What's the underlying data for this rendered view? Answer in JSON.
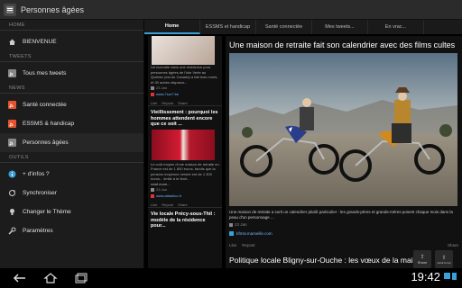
{
  "app": {
    "title": "Personnes âgées"
  },
  "sidebar": {
    "sections": [
      {
        "header": "HOME",
        "items": [
          {
            "label": "BIENVENUE",
            "icon": "home-icon"
          }
        ]
      },
      {
        "header": "TWEETS",
        "items": [
          {
            "label": "Tous mes tweets",
            "icon": "rss-icon"
          }
        ]
      },
      {
        "header": "NEWS",
        "items": [
          {
            "label": "Santé connectée",
            "icon": "rss-icon"
          },
          {
            "label": "ESSMS & handicap",
            "icon": "rss-icon"
          },
          {
            "label": "Personnes âgées",
            "icon": "rss-icon"
          }
        ]
      },
      {
        "header": "OUTILS",
        "items": [
          {
            "label": "+ d'infos ?",
            "icon": "info-icon"
          },
          {
            "label": "Synchroniser",
            "icon": "sync-icon"
          },
          {
            "label": "Changer le Thème",
            "icon": "bulb-icon"
          },
          {
            "label": "Paramètres",
            "icon": "wrench-icon"
          }
        ]
      }
    ]
  },
  "tabs": [
    "Home",
    "ESSMS et handicap",
    "Santé connectée",
    "Mes tweets...",
    "En vrac..."
  ],
  "feed": {
    "post1": {
      "text": "Un incendie dans une résidence pour personnes âgées de l'Isle Verte au Québec (est du Canada) a fait trois morts, et 30 autres disparus...",
      "date": "23 Jan",
      "source": "www.7sur7.be",
      "actions": [
        "Like",
        "Repost",
        "Share"
      ]
    },
    "post2": {
      "title": "Vieillissement : pourquoi les hommes attendent encore que ce soit ...",
      "text": "Le coût moyen d'une maison de retraite en France est de 1 800 euros, tandis que la pension moyenne versée est de 1 300 euros... limite à le tiroir...",
      "more": "read more...",
      "date": "23 Jan",
      "source": "www.atlantico.fr",
      "actions": [
        "Like",
        "Repost",
        "Share"
      ]
    },
    "post3": {
      "title": "Vie locale Précy-sous-Thil : modèle de la résidence pour..."
    }
  },
  "article": {
    "title": "Une maison de retraite fait son calendrier avec des films cultes",
    "body": "Une maison de retraite a sorti un calendrier plutôt particulier : les grands-pères et grands-mères posent chaque mois dans la peau d'un personnage ...",
    "date": "23 Jan",
    "source": "bfmtv.marseille.com",
    "actions": [
      "Like",
      "Repost",
      "Share"
    ],
    "next_title": "Politique locale Bligny-sur-Ouche : les vœux de la maire"
  },
  "floating": {
    "share": "Share",
    "top": "scroll to top"
  },
  "status": {
    "time": "19:42"
  },
  "colors": {
    "accent": "#3aa0d8",
    "link": "#6fb7ff"
  }
}
